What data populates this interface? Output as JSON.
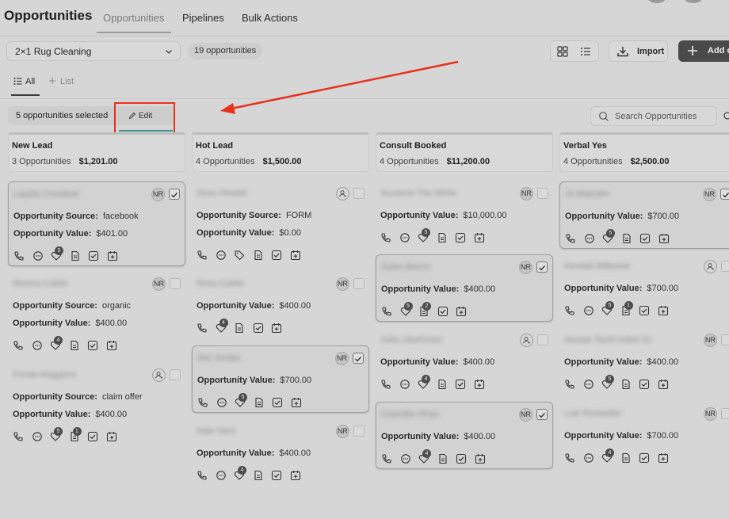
{
  "header": {
    "title": "Opportunities",
    "tabs": [
      {
        "label": "Opportunities",
        "active": true
      },
      {
        "label": "Pipelines",
        "active": false
      },
      {
        "label": "Bulk Actions",
        "active": false
      }
    ]
  },
  "toolbar": {
    "pipeline_select": "2×1 Rug Cleaning",
    "opportunity_count": "19 opportunities",
    "import_label": "Import",
    "add_label": "Add o"
  },
  "view_tabs": {
    "all_label": "All",
    "list_label": "List"
  },
  "selection": {
    "selected_text": "5 opportunities selected",
    "edit_label": "Edit"
  },
  "search": {
    "placeholder": "Search Opportunities"
  },
  "colors": {
    "accent_underline": "#3f8f8c",
    "highlight_red": "#e8321c",
    "add_button_bg": "#4a4a4a"
  },
  "columns": [
    {
      "name": "New Lead",
      "count": "3 Opportunities",
      "total": "$1,201.00",
      "cards": [
        {
          "name": "Layola Crowland",
          "owner": "NR",
          "checked": true,
          "selected": true,
          "fields": [
            {
              "label": "Opportunity Source:",
              "value": "facebook"
            },
            {
              "label": "Opportunity Value:",
              "value": "$401.00"
            }
          ],
          "icons": [
            "phone-icon",
            "chat-icon",
            "tag-heart-icon",
            "document-icon",
            "checkbox-icon",
            "calendar-icon"
          ],
          "badges": {
            "tag-heart-icon": "5"
          }
        },
        {
          "name": "Monica Calder",
          "owner": "NR",
          "checked": false,
          "selected": false,
          "fields": [
            {
              "label": "Opportunity Source:",
              "value": "organic"
            },
            {
              "label": "Opportunity Value:",
              "value": "$400.00"
            }
          ],
          "icons": [
            "phone-icon",
            "chat-icon",
            "tag-heart-icon",
            "document-icon",
            "checkbox-icon",
            "calendar-icon"
          ],
          "badges": {
            "tag-heart-icon": "4"
          }
        },
        {
          "name": "Fonda Maggiore",
          "owner": "user",
          "checked": false,
          "selected": false,
          "fields": [
            {
              "label": "Opportunity Source:",
              "value": "claim offer"
            },
            {
              "label": "Opportunity Value:",
              "value": "$400.00"
            }
          ],
          "icons": [
            "phone-icon",
            "chat-icon",
            "tag-heart-icon",
            "document-icon",
            "checkbox-icon",
            "calendar-icon"
          ],
          "badges": {
            "tag-heart-icon": "5",
            "document-icon": "1"
          }
        }
      ]
    },
    {
      "name": "Hot Lead",
      "count": "4 Opportunities",
      "total": "$1,500.00",
      "cards": [
        {
          "name": "Sean Hewett",
          "owner": "user",
          "checked": false,
          "selected": false,
          "fields": [
            {
              "label": "Opportunity Source:",
              "value": "FORM"
            },
            {
              "label": "Opportunity Value:",
              "value": "$0.00"
            }
          ],
          "icons": [
            "phone-icon",
            "chat-icon",
            "tag-icon",
            "document-icon",
            "checkbox-icon",
            "calendar-icon"
          ],
          "badges": {}
        },
        {
          "name": "Rosa Calder",
          "owner": "NR",
          "checked": false,
          "selected": false,
          "fields": [
            {
              "label": "Opportunity Value:",
              "value": "$400.00"
            }
          ],
          "icons": [
            "phone-icon",
            "tag-heart-icon",
            "document-icon",
            "checkbox-icon",
            "calendar-icon"
          ],
          "badges": {
            "tag-heart-icon": "4"
          }
        },
        {
          "name": "Mel Jordan",
          "owner": "NR",
          "checked": true,
          "selected": true,
          "fields": [
            {
              "label": "Opportunity Value:",
              "value": "$700.00"
            }
          ],
          "icons": [
            "phone-icon",
            "chat-icon",
            "tag-heart-icon",
            "document-icon",
            "checkbox-icon",
            "calendar-icon"
          ],
          "badges": {
            "tag-heart-icon": "5"
          }
        },
        {
          "name": "Nate Nest",
          "owner": "NR",
          "checked": false,
          "selected": false,
          "fields": [
            {
              "label": "Opportunity Value:",
              "value": "$400.00"
            }
          ],
          "icons": [
            "phone-icon",
            "chat-icon",
            "tag-heart-icon",
            "document-icon",
            "checkbox-icon",
            "calendar-icon"
          ],
          "badges": {
            "tag-heart-icon": "4"
          }
        }
      ]
    },
    {
      "name": "Consult Booked",
      "count": "4 Opportunities",
      "total": "$11,200.00",
      "cards": [
        {
          "name": "Suzanne The White",
          "owner": "NR",
          "checked": false,
          "selected": false,
          "fields": [
            {
              "label": "Opportunity Value:",
              "value": "$10,000.00"
            }
          ],
          "icons": [
            "phone-icon",
            "chat-icon",
            "tag-heart-icon",
            "document-icon",
            "checkbox-icon",
            "calendar-icon"
          ],
          "badges": {
            "tag-heart-icon": "5"
          }
        },
        {
          "name": "Dylan Bacco",
          "owner": "NR",
          "checked": true,
          "selected": true,
          "fields": [
            {
              "label": "Opportunity Value:",
              "value": "$400.00"
            }
          ],
          "icons": [
            "phone-icon",
            "tag-heart-icon",
            "document-icon",
            "checkbox-icon",
            "calendar-icon"
          ],
          "badges": {
            "tag-heart-icon": "5",
            "document-icon": "2"
          }
        },
        {
          "name": "Julia Liberhoren",
          "owner": "user",
          "checked": false,
          "selected": false,
          "fields": [
            {
              "label": "Opportunity Value:",
              "value": "$400.00"
            }
          ],
          "icons": [
            "phone-icon",
            "chat-icon",
            "tag-heart-icon",
            "document-icon",
            "checkbox-icon",
            "calendar-icon"
          ],
          "badges": {
            "tag-heart-icon": "4"
          }
        },
        {
          "name": "Chandler Rhys",
          "owner": "NR",
          "checked": true,
          "selected": true,
          "fields": [
            {
              "label": "Opportunity Value:",
              "value": "$400.00"
            }
          ],
          "icons": [
            "phone-icon",
            "chat-icon",
            "tag-heart-icon",
            "document-icon",
            "checkbox-icon",
            "calendar-icon"
          ],
          "badges": {
            "tag-heart-icon": "4"
          }
        }
      ]
    },
    {
      "name": "Verbal Yes",
      "count": "4 Opportunities",
      "total": "$2,500.00",
      "cards": [
        {
          "name": "Jo Malcolm",
          "owner": "NR",
          "checked": true,
          "selected": true,
          "fields": [
            {
              "label": "Opportunity Value:",
              "value": "$700.00"
            }
          ],
          "icons": [
            "phone-icon",
            "chat-icon",
            "tag-heart-icon",
            "document-icon",
            "checkbox-icon",
            "calendar-icon"
          ],
          "badges": {
            "tag-heart-icon": "5"
          }
        },
        {
          "name": "Kendall Millwood",
          "owner": "user",
          "checked": false,
          "selected": false,
          "fields": [
            {
              "label": "Opportunity Value:",
              "value": "$700.00"
            }
          ],
          "icons": [
            "phone-icon",
            "chat-icon",
            "tag-heart-icon",
            "document-icon",
            "checkbox-icon",
            "calendar-icon"
          ],
          "badges": {
            "tag-heart-icon": "5",
            "document-icon": "1"
          }
        },
        {
          "name": "Ansaar Tazrit Inded Sounakes",
          "owner": "NR",
          "checked": false,
          "selected": false,
          "fields": [
            {
              "label": "Opportunity Value:",
              "value": "$400.00"
            }
          ],
          "icons": [
            "phone-icon",
            "chat-icon",
            "tag-heart-icon",
            "document-icon",
            "checkbox-icon",
            "calendar-icon"
          ],
          "badges": {
            "tag-heart-icon": "5"
          }
        },
        {
          "name": "Loki Rosswiller",
          "owner": "NR",
          "checked": false,
          "selected": false,
          "fields": [
            {
              "label": "Opportunity Value:",
              "value": "$700.00"
            }
          ],
          "icons": [
            "phone-icon",
            "chat-icon",
            "tag-heart-icon",
            "document-icon",
            "checkbox-icon",
            "calendar-icon"
          ],
          "badges": {
            "tag-heart-icon": "4"
          }
        }
      ]
    }
  ]
}
